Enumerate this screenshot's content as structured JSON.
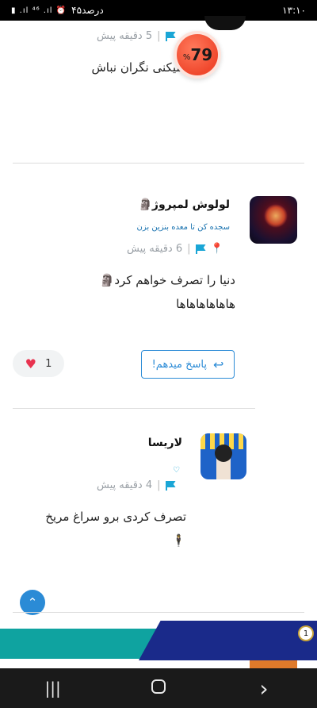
{
  "status_bar": {
    "time": "۱۳:۱۰",
    "battery": "۴۵درصد",
    "icons": "▮ .ıl ⁴⁶ .ıl ⏰"
  },
  "top_comment": {
    "time_ago": "5 دقیقه پیش",
    "text_partial": "دا میکنی نگران نباش"
  },
  "score_badge": {
    "value": "79",
    "unit": "%"
  },
  "comments": [
    {
      "author": "لولوش لمپروژ🗿",
      "subtitle": "سجده کن تا معده بنزین بزن",
      "time_ago": "6 دقیقه پیش",
      "lines": [
        "دنیا را تصرف خواهم کرد🗿",
        "هاهاهاهاهاها"
      ],
      "reply_label": "پاسخ میدهم!",
      "like_count": "1"
    },
    {
      "author": "لاریسا",
      "subtitle_icon": "heart-outline-icon",
      "time_ago": "4 دقیقه پیش",
      "lines": [
        "تصرف کردی برو سراغ مریخ🕴️"
      ]
    }
  ],
  "banner": {
    "badge": "1"
  },
  "nav": {
    "recent": "|||",
    "home": "home-icon",
    "back": "‹"
  },
  "colors": {
    "accent": "#2b8bd6",
    "flag": "#1aa6d6",
    "score": "#f0482d",
    "heart": "#e8334f"
  }
}
